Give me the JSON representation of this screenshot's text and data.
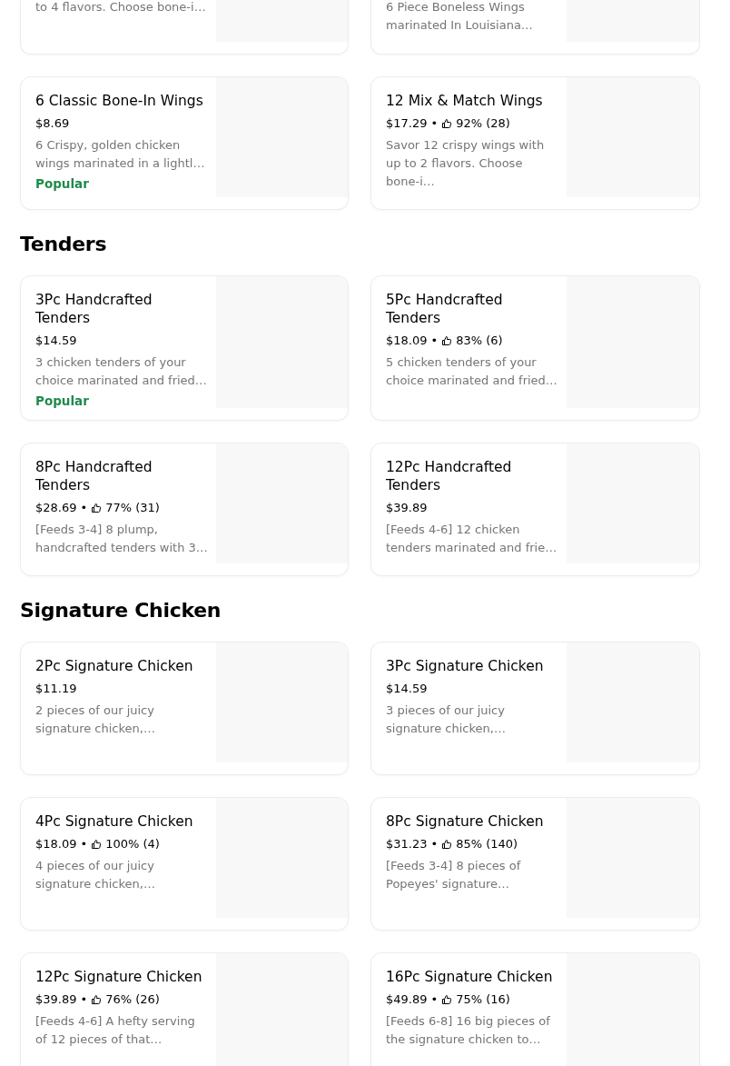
{
  "top_items": [
    {
      "desc": "to 4 flavors. Choose bone-i…"
    },
    {
      "desc": "6 Piece Boneless Wings marinated In Louisiana…"
    }
  ],
  "top_more_items": [
    {
      "title": "6 Classic Bone-In Wings",
      "price": "$8.69",
      "desc": "6 Crispy, golden chicken wings marinated in a lightl…",
      "badge": "Popular"
    },
    {
      "title": "12 Mix & Match Wings",
      "price": "$17.29",
      "dot": "•",
      "rating": "92% (28)",
      "desc": "Savor 12 crispy wings with up to 2 flavors. Choose bone-i…"
    }
  ],
  "sections": [
    {
      "heading": "Tenders",
      "items": [
        {
          "title": "3Pc Handcrafted Tenders",
          "price": "$14.59",
          "desc": "3 chicken tenders of your choice marinated and fried…",
          "badge": "Popular"
        },
        {
          "title": "5Pc Handcrafted Tenders",
          "price": "$18.09",
          "dot": "•",
          "rating": "83% (6)",
          "desc": "5 chicken tenders of your choice marinated and fried…"
        },
        {
          "title": "8Pc Handcrafted Tenders",
          "price": "$28.69",
          "dot": "•",
          "rating": "77% (31)",
          "desc": "[Feeds 3-4] 8 plump, handcrafted tenders with 3…"
        },
        {
          "title": "12Pc Handcrafted Tenders",
          "price": "$39.89",
          "desc": "[Feeds 4-6] 12 chicken tenders marinated and frie…"
        }
      ]
    },
    {
      "heading": "Signature Chicken",
      "items": [
        {
          "title": "2Pc Signature Chicken",
          "price": "$11.19",
          "desc": "2 pieces of our juicy signature chicken,…"
        },
        {
          "title": "3Pc Signature Chicken",
          "price": "$14.59",
          "desc": "3 pieces of our juicy signature chicken,…"
        },
        {
          "title": "4Pc Signature Chicken",
          "price": "$18.09",
          "dot": "•",
          "rating": "100% (4)",
          "desc": "4 pieces of our juicy signature chicken,…"
        },
        {
          "title": "8Pc Signature Chicken",
          "price": "$31.23",
          "dot": "•",
          "rating": "85% (140)",
          "desc": "[Feeds 3-4] 8 pieces of Popeyes' signature…"
        },
        {
          "title": "12Pc Signature Chicken",
          "price": "$39.89",
          "dot": "•",
          "rating": "76% (26)",
          "desc": "[Feeds 4-6] A hefty serving of 12 pieces of that…"
        },
        {
          "title": "16Pc Signature Chicken",
          "price": "$49.89",
          "dot": "•",
          "rating": "75% (16)",
          "desc": "[Feeds 6-8] 16 big pieces of the signature chicken to…"
        }
      ]
    }
  ]
}
